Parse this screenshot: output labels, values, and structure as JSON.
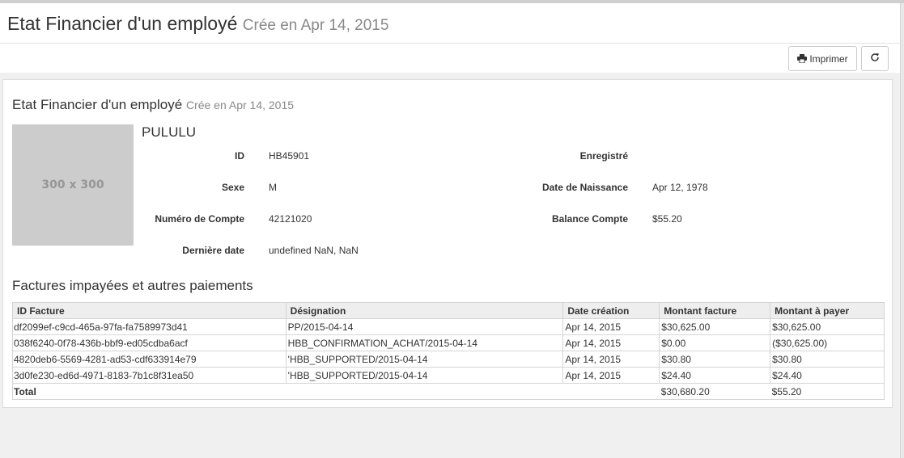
{
  "header": {
    "title": "Etat Financier d'un employé",
    "subtitle": "Crée en Apr 14, 2015"
  },
  "toolbar": {
    "print_label": "Imprimer",
    "print_icon": "print-icon",
    "refresh_icon": "refresh-icon"
  },
  "panel": {
    "title": "Etat Financier d'un employé",
    "subtitle": "Crée en Apr 14, 2015",
    "photo_placeholder": "300 x 300",
    "employee_name": "PULULU",
    "fields": {
      "id_label": "ID",
      "id_value": "HB45901",
      "sex_label": "Sexe",
      "sex_value": "M",
      "account_label": "Numéro de Compte",
      "account_value": "42121020",
      "last_date_label": "Dernière date",
      "last_date_value": "undefined NaN, NaN",
      "registered_label": "Enregistré",
      "registered_value": "",
      "birth_label": "Date de Naissance",
      "birth_value": "Apr 12, 1978",
      "balance_label": "Balance Compte",
      "balance_value": "$55.20"
    },
    "invoices_title": "Factures impayées et autres paiements",
    "table": {
      "headers": [
        "ID Facture",
        "Désignation",
        "Date création",
        "Montant facture",
        "Montant à payer"
      ],
      "rows": [
        [
          "df2099ef-c9cd-465a-97fa-fa7589973d41",
          "PP/2015-04-14",
          "Apr 14, 2015",
          "$30,625.00",
          "$30,625.00"
        ],
        [
          "038f6240-0f78-436b-bbf9-ed05cdba6acf",
          "HBB_CONFIRMATION_ACHAT/2015-04-14",
          "Apr 14, 2015",
          "$0.00",
          "($30,625.00)"
        ],
        [
          "4820deb6-5569-4281-ad53-cdf633914e79",
          "'HBB_SUPPORTED/2015-04-14",
          "Apr 14, 2015",
          "$30.80",
          "$30.80"
        ],
        [
          "3d0fe230-ed6d-4971-8183-7b1c8f31ea50",
          "'HBB_SUPPORTED/2015-04-14",
          "Apr 14, 2015",
          "$24.40",
          "$24.40"
        ]
      ],
      "total_label": "Total",
      "total_invoice": "$30,680.20",
      "total_to_pay": "$55.20"
    }
  }
}
